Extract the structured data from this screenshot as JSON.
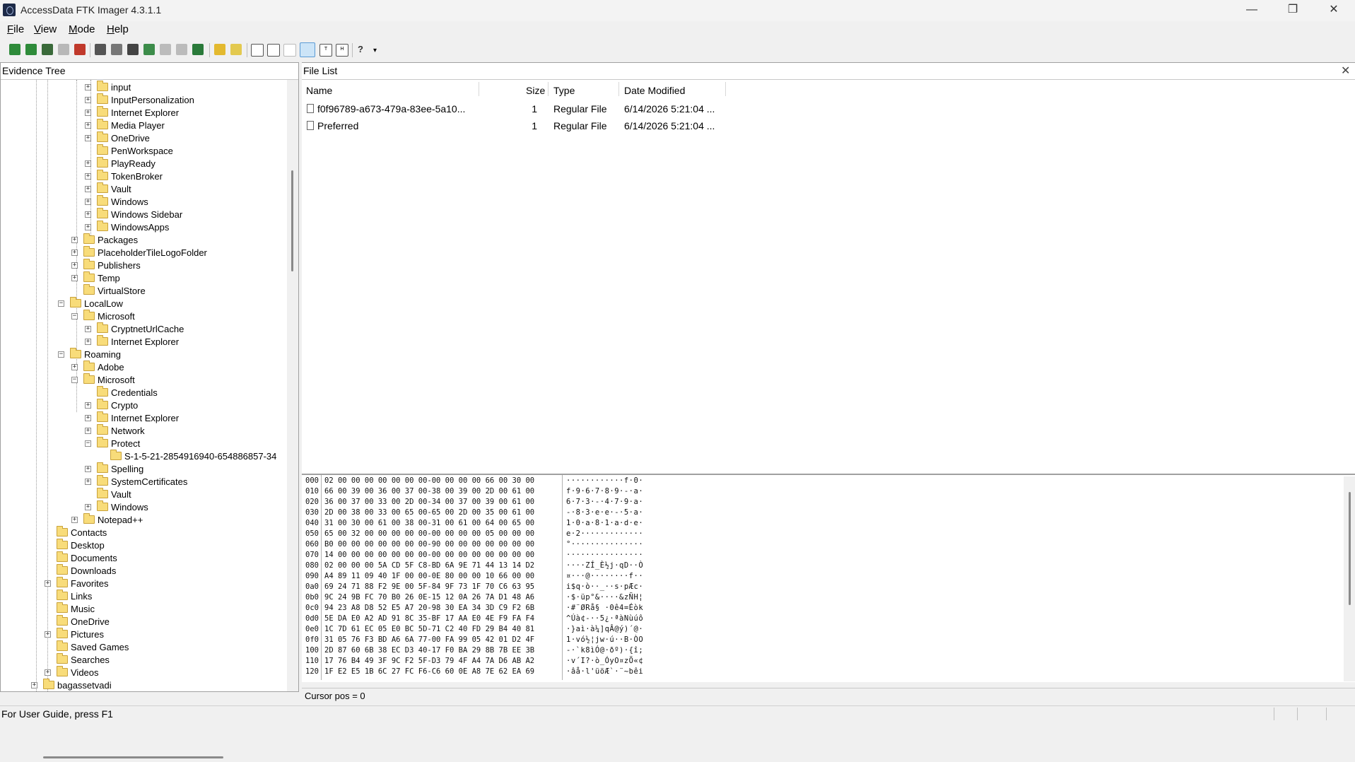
{
  "window": {
    "title": "AccessData FTK Imager 4.3.1.1"
  },
  "menu": [
    {
      "label": "File",
      "key": "F",
      "rest": "ile"
    },
    {
      "label": "View",
      "key": "V",
      "rest": "iew"
    },
    {
      "label": "Mode",
      "key": "M",
      "rest": "ode"
    },
    {
      "label": "Help",
      "key": "H",
      "rest": "elp"
    }
  ],
  "colors": {
    "folder": "#f8dc7a",
    "toolbar_active": "#cce4f7"
  },
  "evidence_tree": {
    "title": "Evidence Tree",
    "items": [
      {
        "label": "input",
        "level": 3,
        "expander": "+"
      },
      {
        "label": "InputPersonalization",
        "level": 3,
        "expander": "+"
      },
      {
        "label": "Internet Explorer",
        "level": 3,
        "expander": "+"
      },
      {
        "label": "Media Player",
        "level": 3,
        "expander": "+"
      },
      {
        "label": "OneDrive",
        "level": 3,
        "expander": "+"
      },
      {
        "label": "PenWorkspace",
        "level": 3,
        "expander": ""
      },
      {
        "label": "PlayReady",
        "level": 3,
        "expander": "+"
      },
      {
        "label": "TokenBroker",
        "level": 3,
        "expander": "+"
      },
      {
        "label": "Vault",
        "level": 3,
        "expander": "+"
      },
      {
        "label": "Windows",
        "level": 3,
        "expander": "+"
      },
      {
        "label": "Windows Sidebar",
        "level": 3,
        "expander": "+"
      },
      {
        "label": "WindowsApps",
        "level": 3,
        "expander": "+"
      },
      {
        "label": "Packages",
        "level": 2,
        "expander": "+"
      },
      {
        "label": "PlaceholderTileLogoFolder",
        "level": 2,
        "expander": "+"
      },
      {
        "label": "Publishers",
        "level": 2,
        "expander": "+"
      },
      {
        "label": "Temp",
        "level": 2,
        "expander": "+"
      },
      {
        "label": "VirtualStore",
        "level": 2,
        "expander": ""
      },
      {
        "label": "LocalLow",
        "level": 1,
        "expander": "-"
      },
      {
        "label": "Microsoft",
        "level": 2,
        "expander": "-"
      },
      {
        "label": "CryptnetUrlCache",
        "level": 3,
        "expander": "+"
      },
      {
        "label": "Internet Explorer",
        "level": 3,
        "expander": "+"
      },
      {
        "label": "Roaming",
        "level": 1,
        "expander": "-"
      },
      {
        "label": "Adobe",
        "level": 2,
        "expander": "+"
      },
      {
        "label": "Microsoft",
        "level": 2,
        "expander": "-"
      },
      {
        "label": "Credentials",
        "level": 3,
        "expander": ""
      },
      {
        "label": "Crypto",
        "level": 3,
        "expander": "+"
      },
      {
        "label": "Internet Explorer",
        "level": 3,
        "expander": "+"
      },
      {
        "label": "Network",
        "level": 3,
        "expander": "+"
      },
      {
        "label": "Protect",
        "level": 3,
        "expander": "-"
      },
      {
        "label": "S-1-5-21-2854916940-654886857-34",
        "level": 4,
        "expander": "",
        "selected": true
      },
      {
        "label": "Spelling",
        "level": 3,
        "expander": "+"
      },
      {
        "label": "SystemCertificates",
        "level": 3,
        "expander": "+"
      },
      {
        "label": "Vault",
        "level": 3,
        "expander": ""
      },
      {
        "label": "Windows",
        "level": 3,
        "expander": "+"
      },
      {
        "label": "Notepad++",
        "level": 2,
        "expander": "+"
      },
      {
        "label": "Contacts",
        "level": 0,
        "expander": ""
      },
      {
        "label": "Desktop",
        "level": 0,
        "expander": ""
      },
      {
        "label": "Documents",
        "level": 0,
        "expander": ""
      },
      {
        "label": "Downloads",
        "level": 0,
        "expander": ""
      },
      {
        "label": "Favorites",
        "level": 0,
        "expander": "+"
      },
      {
        "label": "Links",
        "level": 0,
        "expander": ""
      },
      {
        "label": "Music",
        "level": 0,
        "expander": ""
      },
      {
        "label": "OneDrive",
        "level": 0,
        "expander": ""
      },
      {
        "label": "Pictures",
        "level": 0,
        "expander": "+"
      },
      {
        "label": "Saved Games",
        "level": 0,
        "expander": ""
      },
      {
        "label": "Searches",
        "level": 0,
        "expander": ""
      },
      {
        "label": "Videos",
        "level": 0,
        "expander": "+"
      },
      {
        "label": "bagassetvadi",
        "level": -1,
        "expander": "+"
      }
    ]
  },
  "file_list": {
    "title": "File List",
    "close_glyph": "✕",
    "columns": {
      "name": "Name",
      "size": "Size",
      "type": "Type",
      "date": "Date Modified"
    },
    "rows": [
      {
        "name": "f0f96789-a673-479a-83ee-5a10...",
        "size": "1",
        "type": "Regular File",
        "date": "6/14/2026 5:21:04 ..."
      },
      {
        "name": "Preferred",
        "size": "1",
        "type": "Regular File",
        "date": "6/14/2026 5:21:04 ..."
      }
    ]
  },
  "hex_view": {
    "lines": [
      {
        "offset": "000",
        "bytes": "02 00 00 00 00 00 00 00-00 00 00 00 66 00 30 00",
        "ascii": "············f·0·"
      },
      {
        "offset": "010",
        "bytes": "66 00 39 00 36 00 37 00-38 00 39 00 2D 00 61 00",
        "ascii": "f·9·6·7·8·9·-·a·"
      },
      {
        "offset": "020",
        "bytes": "36 00 37 00 33 00 2D 00-34 00 37 00 39 00 61 00",
        "ascii": "6·7·3·-·4·7·9·a·"
      },
      {
        "offset": "030",
        "bytes": "2D 00 38 00 33 00 65 00-65 00 2D 00 35 00 61 00",
        "ascii": "-·8·3·e·e·-·5·a·"
      },
      {
        "offset": "040",
        "bytes": "31 00 30 00 61 00 38 00-31 00 61 00 64 00 65 00",
        "ascii": "1·0·a·8·1·a·d·e·"
      },
      {
        "offset": "050",
        "bytes": "65 00 32 00 00 00 00 00-00 00 00 00 05 00 00 00",
        "ascii": "e·2·············"
      },
      {
        "offset": "060",
        "bytes": "B0 00 00 00 00 00 00 00-90 00 00 00 00 00 00 00",
        "ascii": "°···············"
      },
      {
        "offset": "070",
        "bytes": "14 00 00 00 00 00 00 00-00 00 00 00 00 00 00 00",
        "ascii": "················"
      },
      {
        "offset": "080",
        "bytes": "02 00 00 00 5A CD 5F C8-BD 6A 9E 71 44 13 14 D2",
        "ascii": "····ZÍ_È½j·qD··Ò"
      },
      {
        "offset": "090",
        "bytes": "A4 89 11 09 40 1F 00 00-0E 80 00 00 10 66 00 00",
        "ascii": "¤···@········f··"
      },
      {
        "offset": "0a0",
        "bytes": "69 24 71 88 F2 9E 00 5F-84 9F 73 1F 70 C6 63 95",
        "ascii": "i$q·ò··_··s·pÆc·"
      },
      {
        "offset": "0b0",
        "bytes": "9C 24 9B FC 70 B0 26 0E-15 12 0A 26 7A D1 48 A6",
        "ascii": "·$·üp°&····&zÑH¦"
      },
      {
        "offset": "0c0",
        "bytes": "94 23 A8 D8 52 E5 A7 20-98 30 EA 34 3D C9 F2 6B",
        "ascii": "·#¨ØRå§ ·0ê4=Éòk"
      },
      {
        "offset": "0d0",
        "bytes": "5E DA E0 A2 AD 91 8C 35-BF 17 AA E0 4E F9 FA F4",
        "ascii": "^Úà¢-··5¿·ªàNùúô"
      },
      {
        "offset": "0e0",
        "bytes": "1C 7D 61 EC 05 E0 BC 5D-71 C2 40 FD 29 B4 40 81",
        "ascii": "·}aì·à¼]qÂ@ý)´@·"
      },
      {
        "offset": "0f0",
        "bytes": "31 05 76 F3 BD A6 6A 77-00 FA 99 05 42 01 D2 4F",
        "ascii": "1·vó½¦jw·ú··B·ÒO"
      },
      {
        "offset": "100",
        "bytes": "2D 87 60 6B 38 EC D3 40-17 F0 BA 29 8B 7B EE 3B",
        "ascii": "-·`k8ìÓ@·ðº)·{î;"
      },
      {
        "offset": "110",
        "bytes": "17 76 B4 49 3F 9C F2 5F-D3 79 4F A4 7A D6 AB A2",
        "ascii": "·v´I?·ò_ÓyO¤zÖ«¢"
      },
      {
        "offset": "120",
        "bytes": "1F E2 E5 1B 6C 27 FC F6-C6 60 0E A8 7E 62 EA 69",
        "ascii": "·âå·l'üöÆ`·¨~bêi"
      }
    ]
  },
  "cursor": {
    "text": "Cursor pos = 0"
  },
  "status": {
    "text": "For User Guide, press F1"
  }
}
